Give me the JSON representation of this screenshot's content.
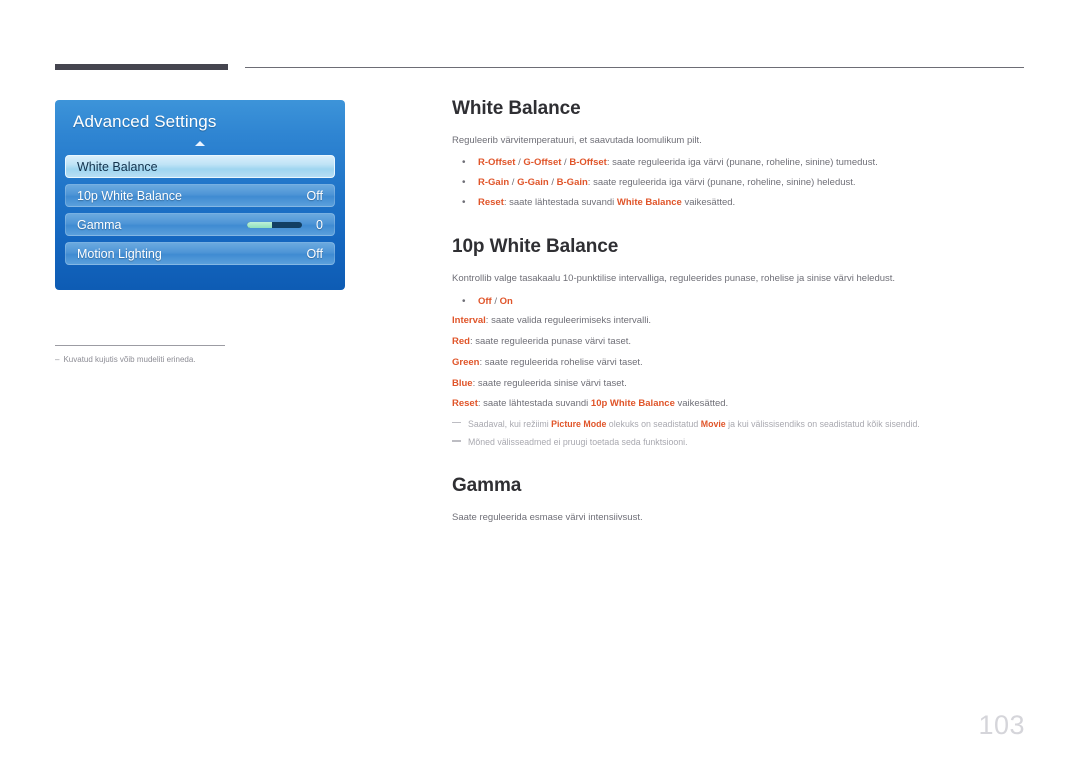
{
  "page": {
    "number": "103"
  },
  "osd": {
    "title": "Advanced Settings",
    "scroll_up_icon": "triangle-up-icon",
    "rows": [
      {
        "label": "White Balance",
        "value": "",
        "selected": true,
        "control": "none"
      },
      {
        "label": "10p White Balance",
        "value": "Off",
        "selected": false,
        "control": "none"
      },
      {
        "label": "Gamma",
        "value": "0",
        "selected": false,
        "control": "slider",
        "slider_percent": 45
      },
      {
        "label": "Motion Lighting",
        "value": "Off",
        "selected": false,
        "control": "none"
      }
    ],
    "footnote": {
      "dash": "–",
      "text": "Kuvatud kujutis võib mudeliti erineda."
    }
  },
  "sections": [
    {
      "title": "White Balance",
      "intro": "Reguleerib värvitemperatuuri, et saavutada loomulikum pilt.",
      "bullets": [
        {
          "kw1": "R-Offset",
          "sep1": " / ",
          "kw2": "G-Offset",
          "sep2": " / ",
          "kw3": "B-Offset",
          "rest": ": saate reguleerida iga värvi (punane, roheline, sinine) tumedust."
        },
        {
          "kw1": "R-Gain",
          "sep1": " / ",
          "kw2": "G-Gain",
          "sep2": " / ",
          "kw3": "B-Gain",
          "rest": ": saate reguleerida iga värvi (punane, roheline, sinine) heledust."
        },
        {
          "kw1": "Reset",
          "rest": ": saate lähtestada suvandi ",
          "kw2": "White Balance",
          "rest2": " vaikesätted."
        }
      ]
    },
    {
      "title": "10p White Balance",
      "intro": "Kontrollib valge tasakaalu 10-punktilise intervalliga, reguleerides punase, rohelise ja sinise värvi heledust.",
      "bullets": [
        {
          "kw1": "Off",
          "sep1": " / ",
          "kw2": "On",
          "rest": ""
        }
      ],
      "lines": [
        {
          "kw": "Interval",
          "rest": ": saate valida reguleerimiseks intervalli."
        },
        {
          "kw": "Red",
          "rest": ": saate reguleerida punase värvi taset."
        },
        {
          "kw": "Green",
          "rest": ": saate reguleerida rohelise värvi taset."
        },
        {
          "kw": "Blue",
          "rest": ": saate reguleerida sinise värvi taset."
        },
        {
          "kw": "Reset",
          "rest": ": saate lähtestada suvandi ",
          "kw2": "10p White Balance",
          "rest2": " vaikesätted."
        }
      ],
      "notes": [
        {
          "a": "Saadaval, kui režiimi ",
          "kw1": "Picture Mode",
          "b": " olekuks on seadistatud ",
          "kw2": "Movie",
          "c": " ja kui välissisendiks on seadistatud kõik sisendid."
        },
        {
          "a": "Mõned välisseadmed ei pruugi toetada seda funktsiooni."
        }
      ]
    },
    {
      "title": "Gamma",
      "intro": "Saate reguleerida esmase värvi intensiivsust."
    }
  ],
  "colors": {
    "accent_orange": "#e0552a",
    "body_gray": "#6f6f77",
    "heading_dark": "#2f2f33",
    "osd_blue": "#1f74c8",
    "page_number_gray": "#d5d5da"
  }
}
